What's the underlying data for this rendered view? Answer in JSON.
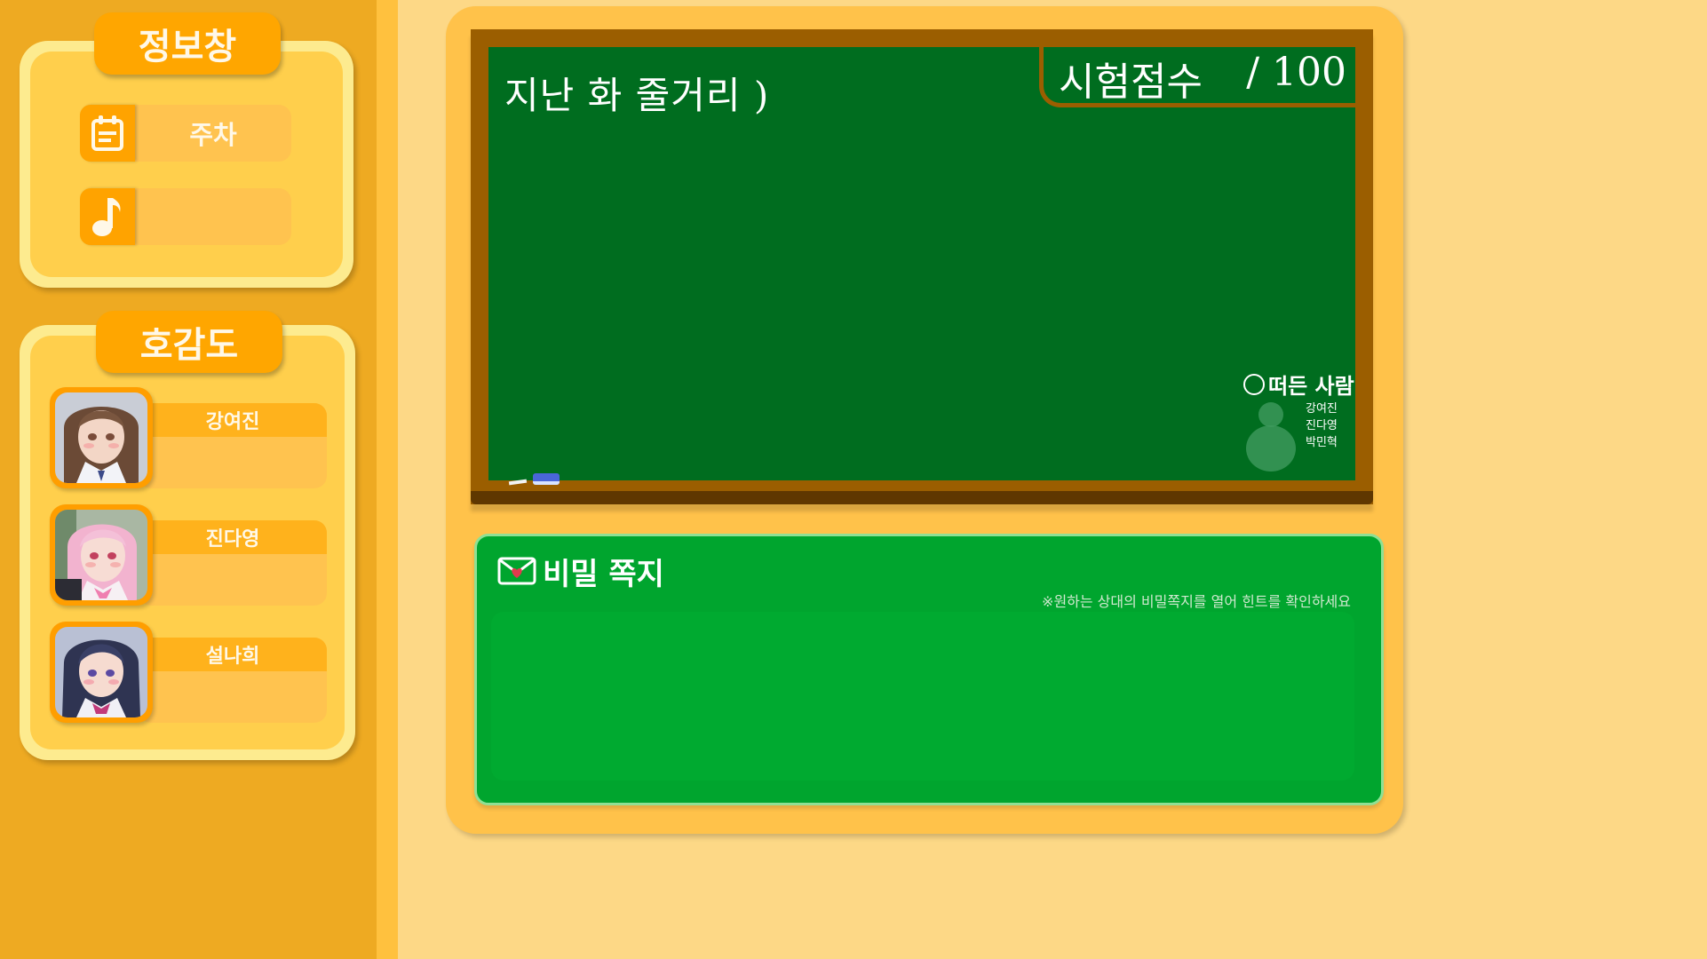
{
  "info_panel": {
    "title": "정보창",
    "rows": [
      {
        "icon": "calendar-icon",
        "label": "주차"
      },
      {
        "icon": "music-note-icon",
        "label": ""
      }
    ]
  },
  "affinity_panel": {
    "title": "호감도",
    "characters": [
      {
        "name": "강여진",
        "portrait": "brown-hair-girl-portrait"
      },
      {
        "name": "진다영",
        "portrait": "pink-hair-girl-portrait"
      },
      {
        "name": "설나희",
        "portrait": "navy-hair-girl-portrait"
      }
    ]
  },
  "board": {
    "title": "지난 화 줄거리 )",
    "score_label": "시험점수",
    "score_max": "/ 100",
    "credits_title": "떠든 사람",
    "credits_names": [
      "강여진",
      "진다영",
      "박민혁"
    ]
  },
  "secret_note": {
    "icon": "heart-envelope-icon",
    "title": "비밀 쪽지",
    "hint": "※원하는 상대의 비밀쪽지를 열어 힌트를 확인하세요"
  },
  "colors": {
    "sidebar": "#eeaa22",
    "background": "#fdd886",
    "chalkboard": "#006d1f",
    "board_frame": "#9b5e00",
    "note_panel": "#00a52e",
    "accent_orange": "#ffa600"
  }
}
